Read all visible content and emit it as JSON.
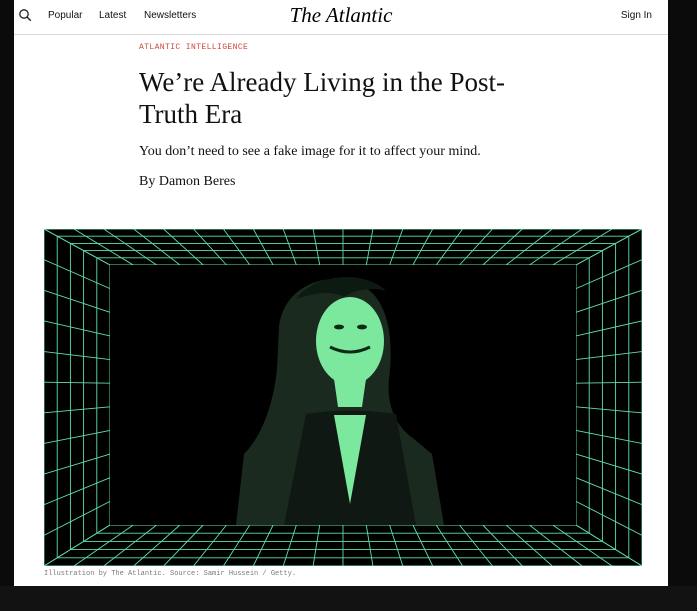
{
  "nav": {
    "links": [
      "Popular",
      "Latest",
      "Newsletters"
    ],
    "logo": "The Atlantic",
    "signin": "Sign In"
  },
  "article": {
    "kicker": "ATLANTIC INTELLIGENCE",
    "title": "We’re Already Living in the Post-Truth Era",
    "dek": "You don’t need to see a fake image for it to affect your mind.",
    "byline": "By Damon Beres"
  },
  "image": {
    "caption": "Illustration by The Atlantic. Source: Samir Hussein / Getty.",
    "colors": {
      "grid": "#5fe0a6",
      "figure": "#7be89e",
      "background": "#000000"
    }
  }
}
